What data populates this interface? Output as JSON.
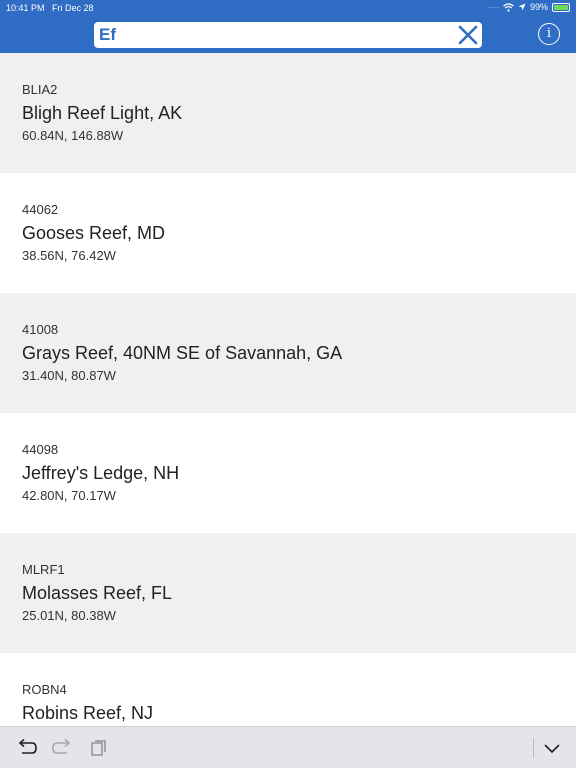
{
  "status_bar": {
    "time": "10:41 PM",
    "date": "Fri Dec 28",
    "battery": "99%"
  },
  "search": {
    "value": "Ef"
  },
  "stations": [
    {
      "id": "BLIA2",
      "name": "Bligh Reef Light, AK",
      "coords": "60.84N, 146.88W"
    },
    {
      "id": "44062",
      "name": "Gooses Reef, MD",
      "coords": "38.56N, 76.42W"
    },
    {
      "id": "41008",
      "name": "Grays Reef, 40NM SE of Savannah, GA",
      "coords": "31.40N, 80.87W"
    },
    {
      "id": "44098",
      "name": "Jeffrey's Ledge, NH",
      "coords": "42.80N, 70.17W"
    },
    {
      "id": "MLRF1",
      "name": "Molasses Reef, FL",
      "coords": "25.01N, 80.38W"
    },
    {
      "id": "ROBN4",
      "name": "Robins Reef, NJ",
      "coords": ""
    }
  ],
  "icons": {
    "clear": "close-icon",
    "info": "info-icon",
    "undo": "undo-icon",
    "redo": "redo-icon",
    "paste": "paste-icon",
    "dismiss": "chevron-down-icon"
  },
  "colors": {
    "header": "#2f6cc4",
    "row_alt": "#f0f0f0",
    "toolbar": "#e4e5e8"
  }
}
